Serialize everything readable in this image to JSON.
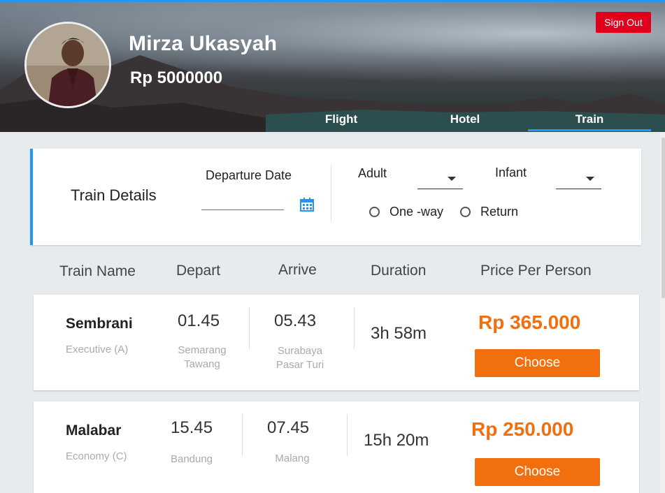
{
  "user": {
    "name": "Mirza Ukasyah",
    "balance": "Rp  5000000"
  },
  "header": {
    "signout_label": "Sign Out",
    "tabs": [
      {
        "label": "Flight"
      },
      {
        "label": "Hotel"
      },
      {
        "label": "Train",
        "active": true
      }
    ]
  },
  "filter": {
    "title": "Train Details",
    "departure_label": "Departure Date",
    "departure_value": "",
    "adult_label": "Adult",
    "adult_value": "",
    "infant_label": "Infant",
    "infant_value": "",
    "trip_options": [
      "One -way",
      "Return"
    ]
  },
  "columns": [
    "Train Name",
    "Depart",
    "Arrive",
    "Duration",
    "Price Per Person"
  ],
  "trains": [
    {
      "name": "Sembrani",
      "class": "Executive (A)",
      "depart_time": "01.45",
      "depart_station_1": "Semarang",
      "depart_station_2": "Tawang",
      "arrive_time": "05.43",
      "arrive_station_1": "Surabaya",
      "arrive_station_2": "Pasar Turi",
      "duration": "3h 58m",
      "price": "Rp 365.000",
      "button": "Choose"
    },
    {
      "name": "Malabar",
      "class": "Economy (C)",
      "depart_time": "15.45",
      "depart_station_1": "Bandung",
      "depart_station_2": "",
      "arrive_time": "07.45",
      "arrive_station_1": "Malang",
      "arrive_station_2": "",
      "duration": "15h 20m",
      "price": "Rp 250.000",
      "button": "Choose"
    }
  ],
  "colors": {
    "accent": "#2196f3",
    "signout": "#e0001b",
    "price": "#f26f0f",
    "button": "#f26f0f"
  }
}
